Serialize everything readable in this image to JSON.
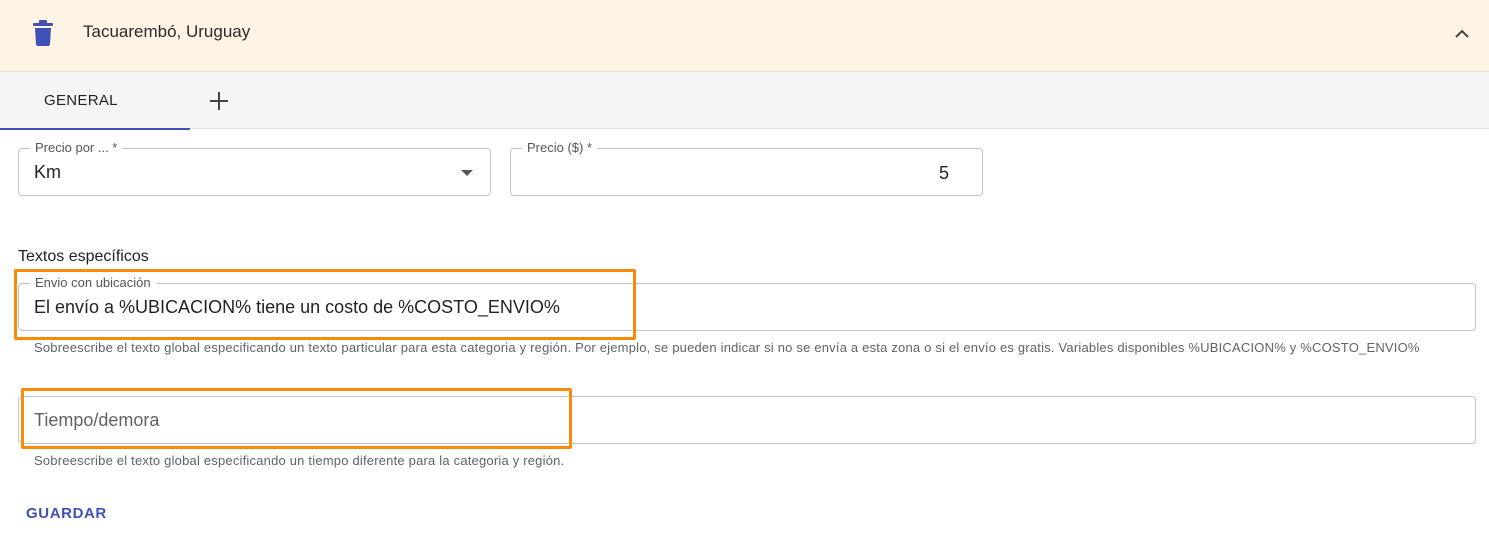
{
  "header": {
    "title": "Tacuarembó, Uruguay",
    "delete_icon": "trash-icon",
    "collapse_icon": "chevron-up-icon",
    "background": "#fff3e4",
    "icon_color": "#3f51b5"
  },
  "tabs": [
    {
      "label": "GENERAL",
      "active": true
    }
  ],
  "add_tab_icon": "plus-icon",
  "pricing": {
    "per_label": "Precio por ... *",
    "per_value": "Km",
    "price_label": "Precio ($) *",
    "price_value": "5"
  },
  "specific_texts": {
    "section_title": "Textos específicos",
    "shipping": {
      "label": "Envio con ubicación",
      "value": "El envío a %UBICACION% tiene un costo de %COSTO_ENVIO%",
      "helper": "Sobreescribe el texto global especificando un texto particular para esta categoria y región. Por ejemplo, se pueden indicar si no se envía a esta zona o si el envío es gratis. Variables disponibles %UBICACION% y %COSTO_ENVIO%"
    },
    "time": {
      "placeholder": "Tiempo/demora",
      "helper": "Sobreescribe el texto global especificando un tiempo diferente para la categoria y región."
    }
  },
  "actions": {
    "save_label": "GUARDAR"
  },
  "colors": {
    "accent": "#3f51b5",
    "highlight": "#f98a0a"
  }
}
